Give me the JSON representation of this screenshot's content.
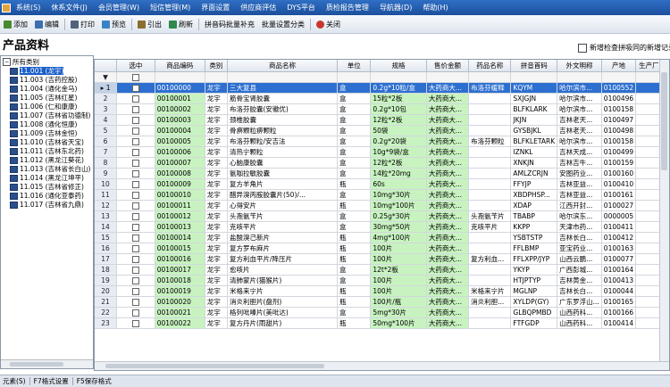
{
  "menubar": {
    "items": [
      "系统(S)",
      "休系文件(J)",
      "会员管理(W)",
      "短信管理(M)",
      "界面设置",
      "供应商评估",
      "DYS平台",
      "质检报告管理",
      "导航器(D)",
      "帮助(H)"
    ]
  },
  "toolbar": {
    "items": [
      {
        "label": "添加",
        "icon": "add-icon",
        "color": "#4a8a2e"
      },
      {
        "label": "编辑",
        "icon": "edit-icon",
        "color": "#3d6fb0"
      },
      {
        "label": "打印",
        "icon": "print-icon",
        "color": "#52627a"
      },
      {
        "label": "预览",
        "icon": "preview-icon",
        "color": "#3b82c4"
      },
      {
        "label": "引出",
        "icon": "export-icon",
        "color": "#8b6d2f"
      },
      {
        "label": "刷新",
        "icon": "refresh-icon",
        "color": "#2e8a4a"
      },
      {
        "label": "拼音码批量补充",
        "icon": "",
        "color": ""
      },
      {
        "label": "批量设置分类",
        "icon": "",
        "color": ""
      },
      {
        "label": "关闭",
        "icon": "close-icon",
        "color": "#c8372d"
      }
    ]
  },
  "page": {
    "title": "产品资料",
    "checkbox_label": "新增检查拼吸同的新增记录"
  },
  "tree": {
    "root": "所有类别",
    "items": [
      "11.001 (龙宇)",
      "11.003 (吉药控股)",
      "11.004 (通化金马)",
      "11.005 (吉林红星)",
      "11.006 (仁和康康)",
      "11.007 (吉林省功德制)",
      "11.008 (通化恒康)",
      "11.009 (吉林金恒)",
      "11.010 (吉林省天宝)",
      "11.011 (吉林东北药)",
      "11.012 (黑龙江葵花)",
      "11.013 (吉林省长白山)",
      "11.014 (黑龙江坤平)",
      "11.015 (吉林省修正)",
      "11.016 (通化亚泰药)",
      "11.017 (吉林省九鼎)"
    ]
  },
  "grid": {
    "columns": [
      "选中",
      "商品编码",
      "类别",
      "商品名称",
      "单位",
      "规格",
      "售价金额",
      "药品名称",
      "拼音首码",
      "外文明称",
      "产地",
      "生产厂家"
    ],
    "rows": [
      [
        "00100000",
        "龙宇",
        "三大复县",
        "盒",
        "0.2g*10粒/盒",
        "大药商大...",
        "布洛芬缓释",
        "KQYM",
        "哈尔滨市...",
        "0100552"
      ],
      [
        "00100001",
        "龙宇",
        "筋骨宝肾胶囊",
        "盒",
        "15粒*2板",
        "大药商大...",
        "",
        "SXJGJN",
        "哈尔滨市...",
        "0100496"
      ],
      [
        "00100002",
        "龙宇",
        "布洛芬胶囊(安徽优)",
        "盒",
        "0.2g*10包",
        "大药商大...",
        "",
        "BLFKLARK",
        "哈尔滨市...",
        "0100158"
      ],
      [
        "00100003",
        "龙宇",
        "颈椎胶囊",
        "盒",
        "12粒*2板",
        "大药商大...",
        "",
        "JKJN",
        "吉林老天...",
        "0100497"
      ],
      [
        "00100004",
        "龙宇",
        "骨痹颗粒痹颗粒",
        "盒",
        "50袋",
        "大药商大...",
        "",
        "GYSBJKL",
        "吉林老天...",
        "0100498"
      ],
      [
        "00100005",
        "龙宇",
        "布洛芬颗粒/安吉法",
        "盒",
        "0.2g*20袋",
        "大药商大...",
        "布洛芬颗粒",
        "BLFKLETARK",
        "哈尔滨市...",
        "0100158"
      ],
      [
        "00100006",
        "龙宇",
        "清热宁颗粒",
        "盒",
        "10g*9袋/盒",
        "大药商大...",
        "",
        "IZNKL",
        "吉林天成...",
        "0100499"
      ],
      [
        "00100007",
        "龙宇",
        "心脑康胶囊",
        "盒",
        "12粒*2板",
        "大药商大...",
        "",
        "XNKJN",
        "吉林吉牛...",
        "0100159"
      ],
      [
        "00100008",
        "龙宇",
        "氨咖拉敏胶囊",
        "盒",
        "14粒*20mg",
        "大药商大...",
        "",
        "AMLZCRJN",
        "安图药业...",
        "0100160"
      ],
      [
        "00100009",
        "龙宇",
        "复方羊角片",
        "瓶",
        "60s",
        "大药商大...",
        "",
        "FFYJP",
        "吉林亚益...",
        "0100410"
      ],
      [
        "00100010",
        "龙宇",
        "醋异溴丙胺胶囊片(50)/...",
        "盒",
        "10mg*30片",
        "大药商大...",
        "",
        "XBDPHSP...",
        "吉林亚益...",
        "0100161"
      ],
      [
        "00100011",
        "龙宇",
        "心得安片",
        "瓶",
        "10mg*100片",
        "大药商大...",
        "",
        "XDAP",
        "江西开封...",
        "0100027"
      ],
      [
        "00100012",
        "龙宇",
        "头孢氨苄片",
        "盒",
        "0.25g*30片",
        "大药商大...",
        "头孢氨苄片",
        "TBABP",
        "哈尔滨东...",
        "0000005"
      ],
      [
        "00100013",
        "龙宇",
        "克咳平片",
        "盒",
        "30mg*50片",
        "大药商大...",
        "克咳平片",
        "KKPP",
        "天津市药...",
        "0100411"
      ],
      [
        "00100014",
        "龙宇",
        "盐酸溴己新片",
        "瓶",
        "4mg*100片",
        "大药商大...",
        "",
        "YSBTSTP",
        "吉林长白...",
        "0100412"
      ],
      [
        "00100015",
        "龙宇",
        "复方罗布麻片",
        "瓶",
        "100片",
        "大药商大...",
        "",
        "FFLBMP",
        "亚宝药业...",
        "0100163"
      ],
      [
        "00100016",
        "龙宇",
        "复方利血平片/降压片",
        "瓶",
        "100片",
        "大药商大...",
        "复方利血...",
        "FFLXPP/JYP",
        "山西云鹏...",
        "0100077"
      ],
      [
        "00100017",
        "龙宇",
        "愈咳片",
        "盒",
        "12t*2板",
        "大药商大...",
        "",
        "YKYP",
        "广西彭城...",
        "0100164"
      ],
      [
        "00100018",
        "龙宇",
        "清肺蒙片(猫猴片)",
        "盒",
        "100片",
        "大药商大...",
        "",
        "HTJPTYP",
        "吉林黄金...",
        "0100413"
      ],
      [
        "00100019",
        "龙宇",
        "米格来宁片",
        "瓶",
        "100片",
        "大药商大...",
        "米格来宁片",
        "MGLNP",
        "吉林长白...",
        "0100044"
      ],
      [
        "00100020",
        "龙宇",
        "消炎利胆片(盘剂)",
        "瓶",
        "100片/瓶",
        "大药商大...",
        "消炎利胆...",
        "XYLDP(GY)",
        "广东罗浮山...",
        "0100165"
      ],
      [
        "00100021",
        "龙宇",
        "格列吡嗪片(美吡达)",
        "盒",
        "5mg*30片",
        "大药商大...",
        "",
        "GLBQPMBD",
        "山西药科...",
        "0100166"
      ],
      [
        "00100022",
        "龙宇",
        "复方丹片(雨甜片)",
        "瓶",
        "50mg*100片",
        "大药商大...",
        "",
        "FTFGDP",
        "山西药科...",
        "0100414"
      ]
    ]
  },
  "statusbar": {
    "items": [
      "元素(S)",
      "F7格式设置",
      "F5保存格式"
    ]
  }
}
